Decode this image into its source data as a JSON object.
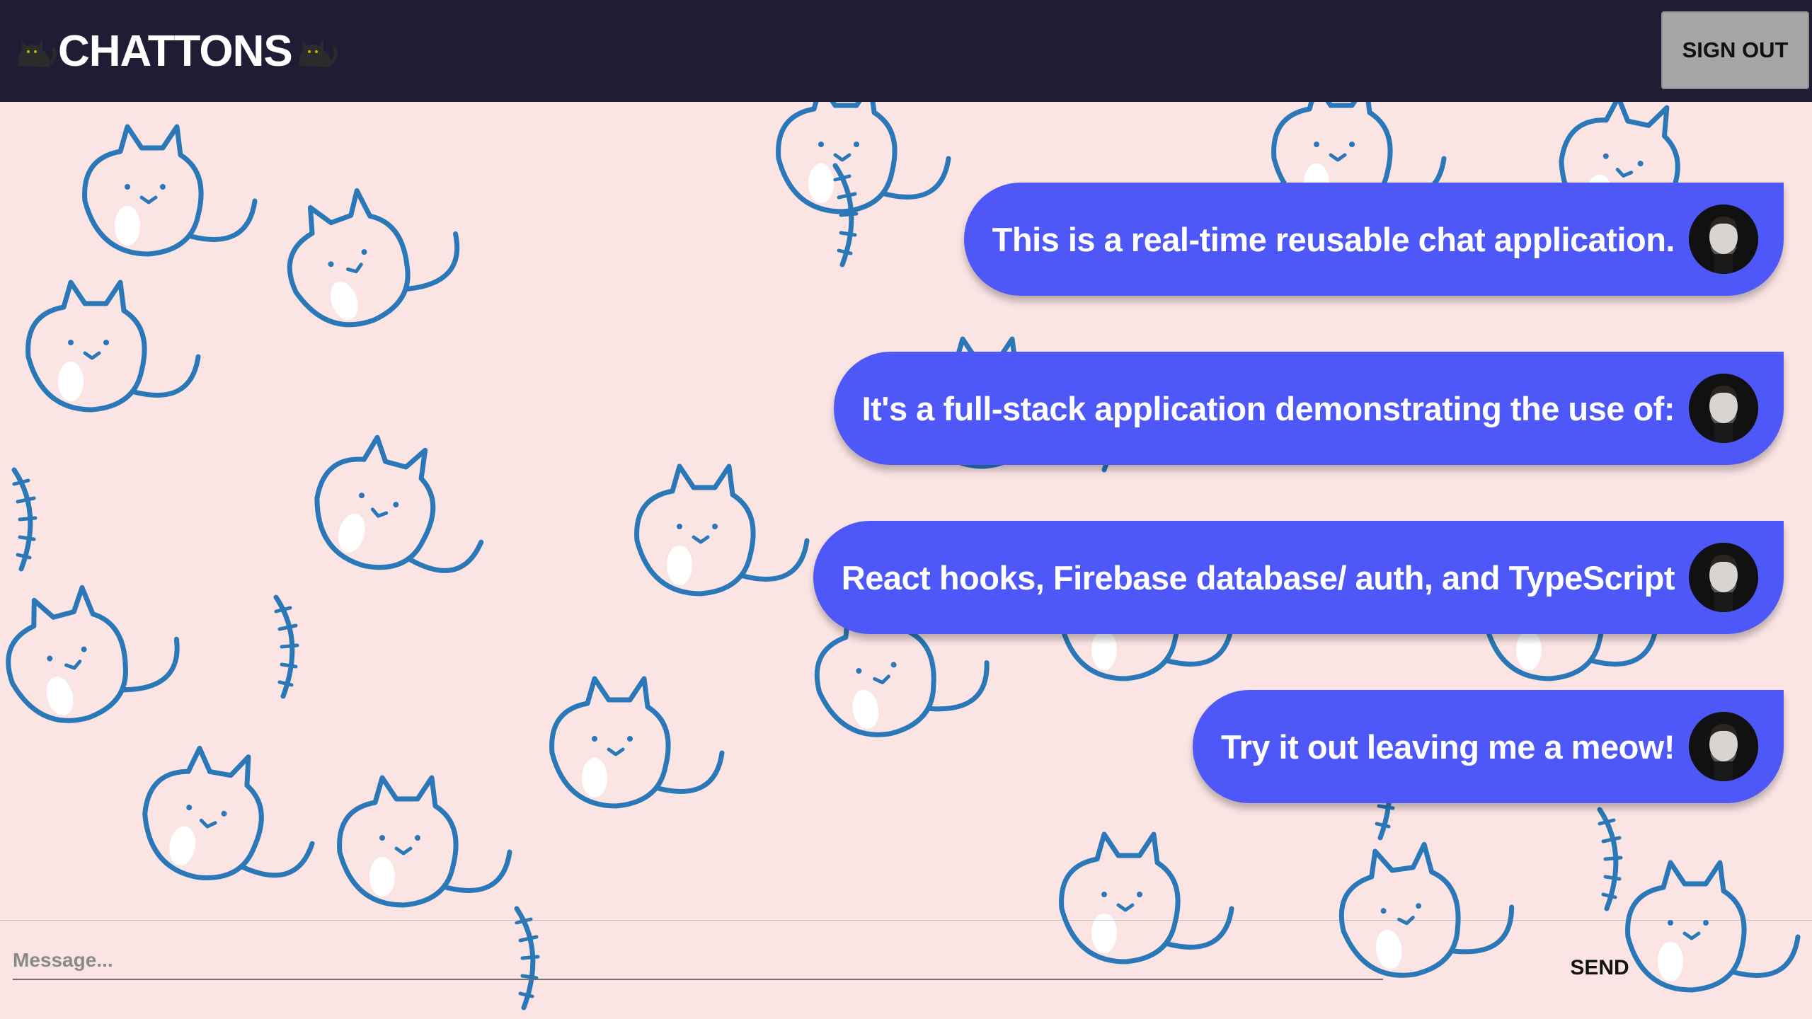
{
  "header": {
    "title": "CHATTONS",
    "left_icon": "black-cat-emoji",
    "right_icon": "black-cat-emoji",
    "sign_out_label": "SIGN OUT"
  },
  "messages": [
    {
      "text": "This is a real-time reusable chat application.",
      "avatar": "user-avatar"
    },
    {
      "text": "It's a full-stack application demonstrating the use of:",
      "avatar": "user-avatar"
    },
    {
      "text": "React hooks, Firebase database/ auth, and TypeScript",
      "avatar": "user-avatar"
    },
    {
      "text": "Try it out leaving me a meow!",
      "avatar": "user-avatar"
    }
  ],
  "composer": {
    "placeholder": "Message...",
    "value": "",
    "send_label": "SEND"
  },
  "colors": {
    "header_bg": "#1f1d33",
    "bubble": "#4e57f7",
    "background": "#fbe4e4",
    "pattern_stroke": "#2a78b8",
    "sign_out_bg": "#a6a6a9"
  }
}
